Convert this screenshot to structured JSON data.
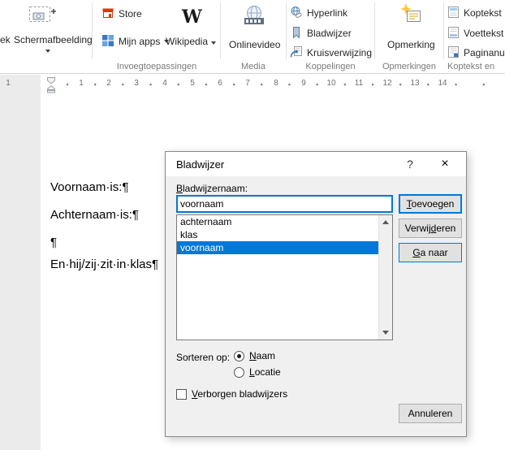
{
  "ribbon": {
    "partial_chart_label": "ek",
    "screenshot": {
      "label": "Schermafbeelding"
    },
    "store": {
      "label": "Store"
    },
    "my_apps": {
      "label": "Mijn apps"
    },
    "wikipedia": {
      "label": "Wikipedia",
      "glyph": "W"
    },
    "online_video": {
      "label": "Onlinevideo"
    },
    "hyperlink": {
      "label": "Hyperlink"
    },
    "bookmark": {
      "label": "Bladwijzer"
    },
    "cross_reference": {
      "label": "Kruisverwijzing"
    },
    "comment": {
      "label": "Opmerking"
    },
    "header": {
      "label": "Koptekst"
    },
    "footer": {
      "label": "Voettekst"
    },
    "page_number": {
      "label": "Paginanu"
    },
    "group_labels": [
      "Invoegtoepassingen",
      "Media",
      "Koppelingen",
      "Opmerkingen",
      "Koptekst en"
    ]
  },
  "ruler": {
    "left_margin_number": "1",
    "numbers": [
      "1",
      "2",
      "3",
      "4",
      "5",
      "6",
      "7",
      "8",
      "9",
      "10",
      "11",
      "12",
      "13",
      "14"
    ]
  },
  "document": {
    "lines": [
      "Voornaam·is:¶",
      "Achternaam·is:¶",
      "¶",
      "En·hij/zij·zit·in·klas¶"
    ]
  },
  "dialog": {
    "title": "Bladwijzer",
    "help_glyph": "?",
    "close_glyph": "×",
    "name_label": {
      "label": "Bladwijzernaam:",
      "ak": "B"
    },
    "name_value": "voornaam",
    "list_items": [
      "achternaam",
      "klas",
      "voornaam"
    ],
    "selected_item": "voornaam",
    "buttons": {
      "add": {
        "label": "Toevoegen",
        "ak": "T"
      },
      "delete": {
        "label": "Verwijderen",
        "ak": "d"
      },
      "goto": {
        "label": "Ga naar",
        "ak": "G"
      },
      "cancel": {
        "label": "Annuleren"
      }
    },
    "sort_label": "Sorteren op:",
    "sort_options": [
      {
        "label": "Naam",
        "ak": "N"
      },
      {
        "label": "Locatie",
        "ak": "L"
      }
    ],
    "sort_selected": "Naam",
    "hidden_label": {
      "label": "Verborgen bladwijzers",
      "ak": "V"
    },
    "colors": {
      "accent": "#0078d7",
      "selection_bg": "#0078d7"
    }
  }
}
